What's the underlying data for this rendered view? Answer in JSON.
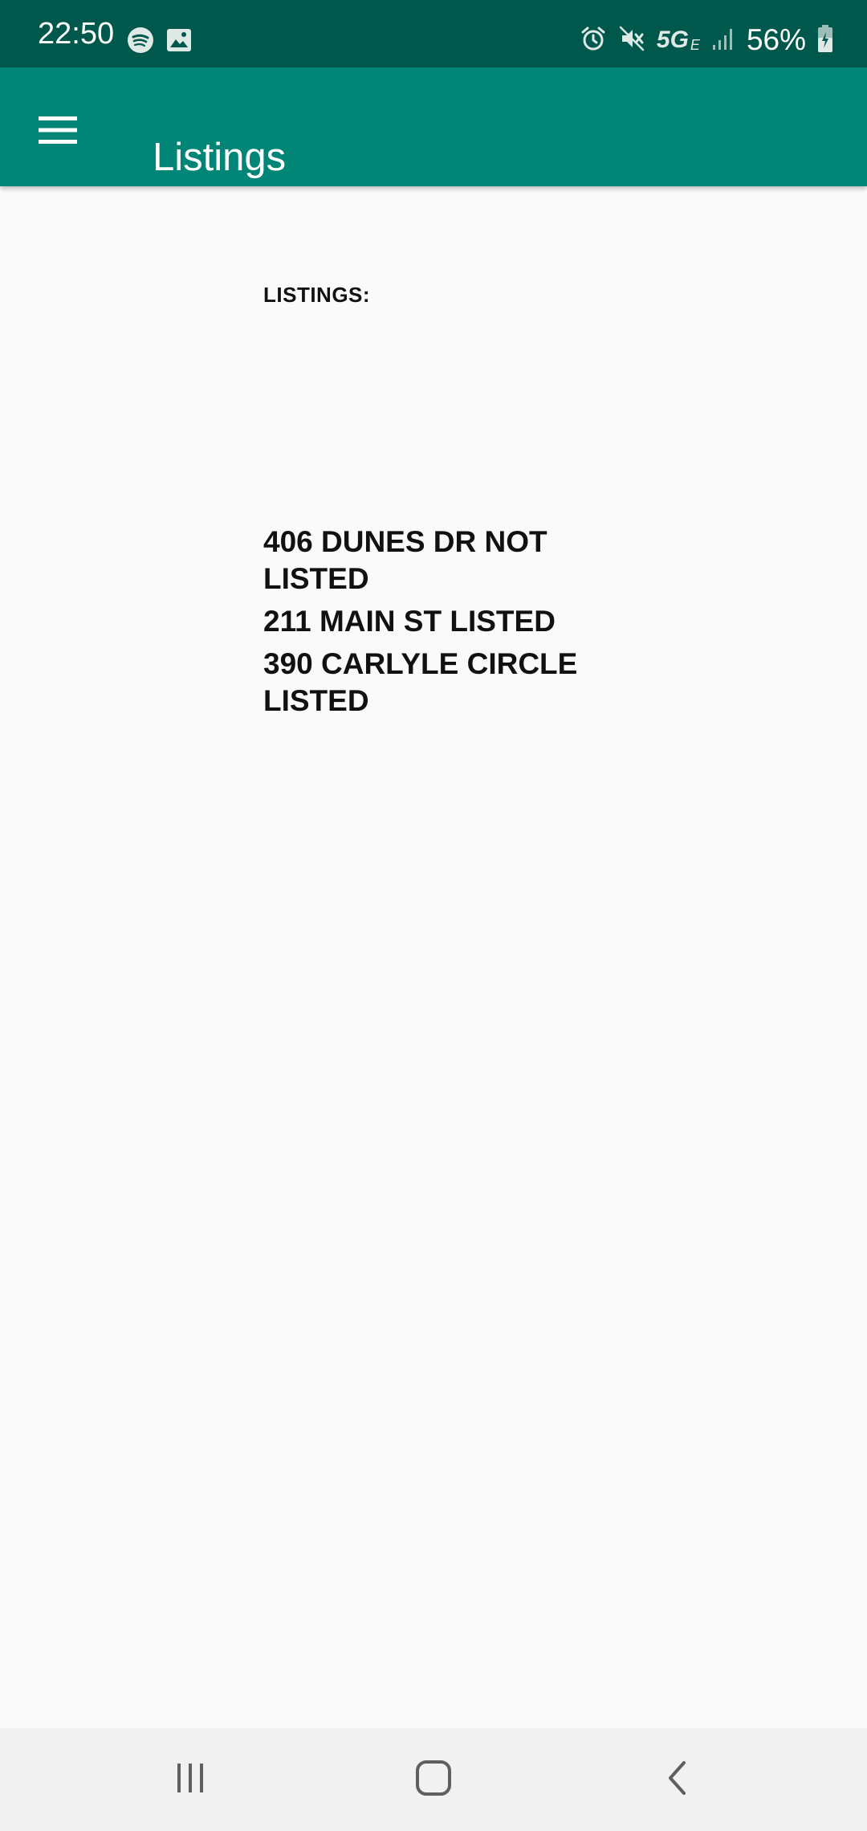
{
  "status_bar": {
    "time": "22:50",
    "battery": "56%",
    "network": "5G",
    "network_sub": "E",
    "left_icons": [
      "spotify-icon",
      "image-icon"
    ],
    "right_icons": [
      "alarm-icon",
      "mute-icon",
      "signal-icon",
      "battery-icon"
    ]
  },
  "app_bar": {
    "title": "Listings",
    "menu_icon": "hamburger-menu-icon",
    "background": "#008577",
    "status_background": "#00574b"
  },
  "main": {
    "header": "LISTINGS:",
    "listings": [
      "406 DUNES DR NOT LISTED",
      "211 MAIN ST LISTED",
      "390 CARLYLE CIRCLE LISTED"
    ]
  },
  "nav_bar": {
    "buttons": [
      "recent-apps-icon",
      "home-icon",
      "back-icon"
    ]
  }
}
